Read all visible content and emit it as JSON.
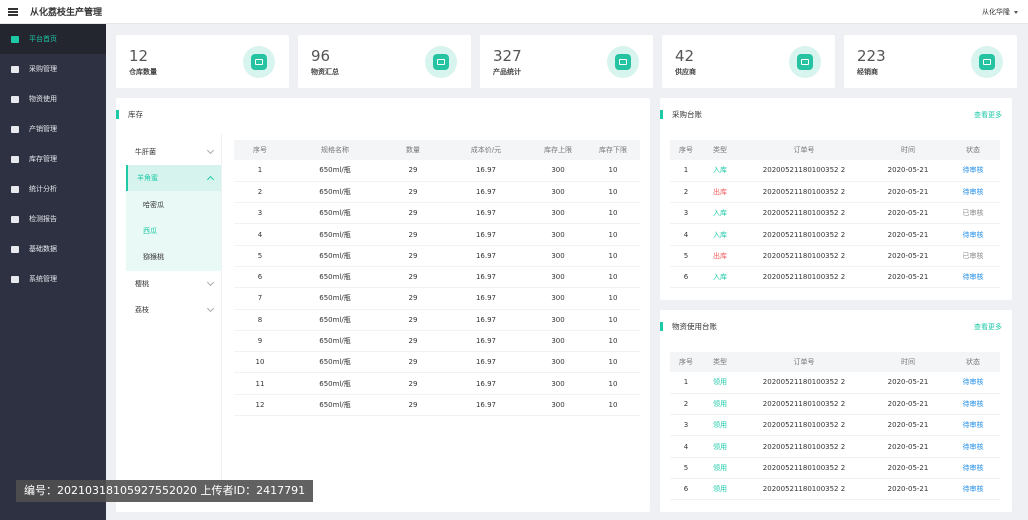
{
  "app": {
    "title": "从化荔枝生产管理",
    "user": "从化华隆"
  },
  "sidebar": {
    "items": [
      {
        "label": "平台首页",
        "icon": "home-icon",
        "active": true
      },
      {
        "label": "采购管理",
        "icon": "purchase-icon"
      },
      {
        "label": "物资使用",
        "icon": "materials-icon"
      },
      {
        "label": "产销管理",
        "icon": "sales-icon"
      },
      {
        "label": "库存管理",
        "icon": "inventory-icon"
      },
      {
        "label": "统计分析",
        "icon": "bar-chart-icon"
      },
      {
        "label": "检测报告",
        "icon": "report-icon"
      },
      {
        "label": "基础数据",
        "icon": "database-icon"
      },
      {
        "label": "系统管理",
        "icon": "grid-icon"
      }
    ]
  },
  "stats": [
    {
      "value": "12",
      "label": "仓库数量",
      "icon": "warehouse-icon"
    },
    {
      "value": "96",
      "label": "物资汇总",
      "icon": "box-icon"
    },
    {
      "value": "327",
      "label": "产品统计",
      "icon": "products-icon"
    },
    {
      "value": "42",
      "label": "供应商",
      "icon": "truck-icon"
    },
    {
      "value": "223",
      "label": "经销商",
      "icon": "store-icon"
    }
  ],
  "inventory": {
    "title": "库存",
    "categories": {
      "first": "牛肝菌",
      "open": "羊角蜜",
      "sub": [
        "哈密瓜",
        "西瓜",
        "猕猴桃"
      ],
      "rest": [
        "樱桃",
        "荔枝"
      ]
    },
    "columns": [
      "序号",
      "规格名称",
      "数量",
      "成本价/元",
      "库存上限",
      "库存下限"
    ],
    "rows": [
      [
        "1",
        "650ml/瓶",
        "29",
        "16.97",
        "300",
        "10"
      ],
      [
        "2",
        "650ml/瓶",
        "29",
        "16.97",
        "300",
        "10"
      ],
      [
        "3",
        "650ml/瓶",
        "29",
        "16.97",
        "300",
        "10"
      ],
      [
        "4",
        "650ml/瓶",
        "29",
        "16.97",
        "300",
        "10"
      ],
      [
        "5",
        "650ml/瓶",
        "29",
        "16.97",
        "300",
        "10"
      ],
      [
        "6",
        "650ml/瓶",
        "29",
        "16.97",
        "300",
        "10"
      ],
      [
        "7",
        "650ml/瓶",
        "29",
        "16.97",
        "300",
        "10"
      ],
      [
        "8",
        "650ml/瓶",
        "29",
        "16.97",
        "300",
        "10"
      ],
      [
        "9",
        "650ml/瓶",
        "29",
        "16.97",
        "300",
        "10"
      ],
      [
        "10",
        "650ml/瓶",
        "29",
        "16.97",
        "300",
        "10"
      ],
      [
        "11",
        "650ml/瓶",
        "29",
        "16.97",
        "300",
        "10"
      ],
      [
        "12",
        "650ml/瓶",
        "29",
        "16.97",
        "300",
        "10"
      ]
    ]
  },
  "purchase": {
    "title": "采购台账",
    "more": "查看更多",
    "columns": [
      "序号",
      "类型",
      "订单号",
      "时间",
      "状态"
    ],
    "rows": [
      [
        "1",
        "入库",
        "20200521180100352 2",
        "2020-05-21",
        "待审核"
      ],
      [
        "2",
        "出库",
        "20200521180100352 2",
        "2020-05-21",
        "待审核"
      ],
      [
        "3",
        "入库",
        "20200521180100352 2",
        "2020-05-21",
        "已审核"
      ],
      [
        "4",
        "入库",
        "20200521180100352 2",
        "2020-05-21",
        "待审核"
      ],
      [
        "5",
        "出库",
        "20200521180100352 2",
        "2020-05-21",
        "已审核"
      ],
      [
        "6",
        "入库",
        "20200521180100352 2",
        "2020-05-21",
        "待审核"
      ]
    ]
  },
  "usage": {
    "title": "物资使用台账",
    "more": "查看更多",
    "columns": [
      "序号",
      "类型",
      "订单号",
      "时间",
      "状态"
    ],
    "rows": [
      [
        "1",
        "领用",
        "20200521180100352 2",
        "2020-05-21",
        "待审核"
      ],
      [
        "2",
        "领用",
        "20200521180100352 2",
        "2020-05-21",
        "待审核"
      ],
      [
        "3",
        "领用",
        "20200521180100352 2",
        "2020-05-21",
        "待审核"
      ],
      [
        "4",
        "领用",
        "20200521180100352 2",
        "2020-05-21",
        "待审核"
      ],
      [
        "5",
        "领用",
        "20200521180100352 2",
        "2020-05-21",
        "待审核"
      ],
      [
        "6",
        "领用",
        "20200521180100352 2",
        "2020-05-21",
        "待审核"
      ]
    ]
  },
  "watermark": "编号：20210318105927552020 上传者ID：2417791"
}
